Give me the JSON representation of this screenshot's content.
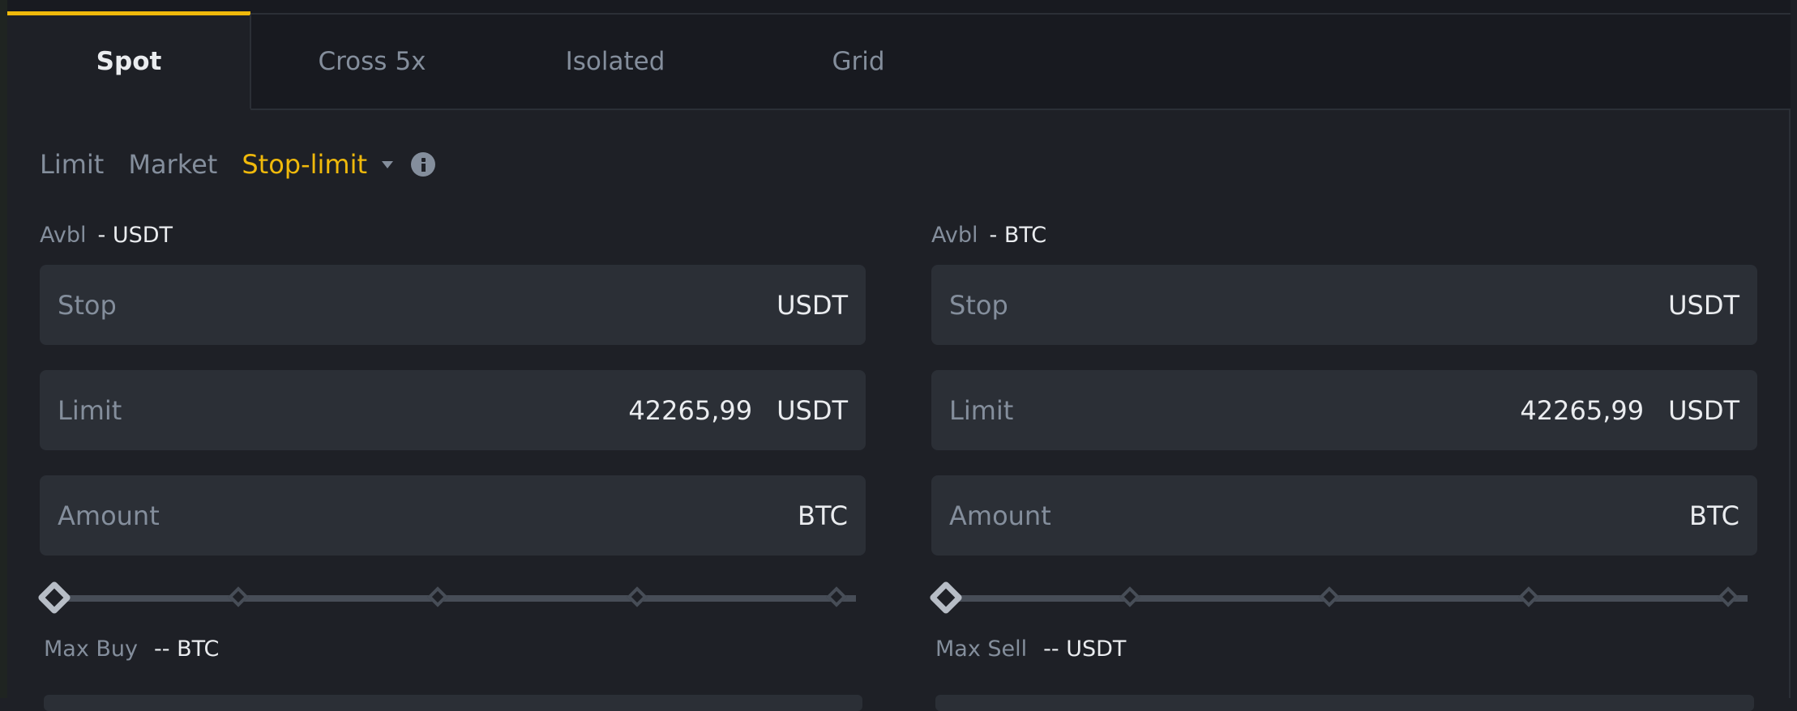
{
  "tabs": [
    {
      "label": "Spot",
      "sub": "",
      "active": true
    },
    {
      "label": "Cross",
      "sub": "5x",
      "active": false
    },
    {
      "label": "Isolated",
      "sub": "",
      "active": false
    },
    {
      "label": "Grid",
      "sub": "",
      "active": false
    }
  ],
  "order_types": {
    "limit": "Limit",
    "market": "Market",
    "stop_limit": "Stop-limit",
    "selected": "Stop-limit"
  },
  "accent_color": "#f0b90b",
  "buy": {
    "avbl_label": "Avbl",
    "avbl_value": "- USDT",
    "stop": {
      "placeholder": "Stop",
      "value": "",
      "unit": "USDT"
    },
    "limit": {
      "placeholder": "Limit",
      "value": "42265,99",
      "unit": "USDT"
    },
    "amount": {
      "placeholder": "Amount",
      "value": "",
      "unit": "BTC"
    },
    "slider_percent": 0,
    "max_label": "Max Buy",
    "max_value": "-- BTC"
  },
  "sell": {
    "avbl_label": "Avbl",
    "avbl_value": "- BTC",
    "stop": {
      "placeholder": "Stop",
      "value": "",
      "unit": "USDT"
    },
    "limit": {
      "placeholder": "Limit",
      "value": "42265,99",
      "unit": "USDT"
    },
    "amount": {
      "placeholder": "Amount",
      "value": "",
      "unit": "BTC"
    },
    "slider_percent": 0,
    "max_label": "Max Sell",
    "max_value": "-- USDT"
  },
  "icons": {
    "order_type_dropdown": "caret-down-icon",
    "info": "info-icon"
  }
}
